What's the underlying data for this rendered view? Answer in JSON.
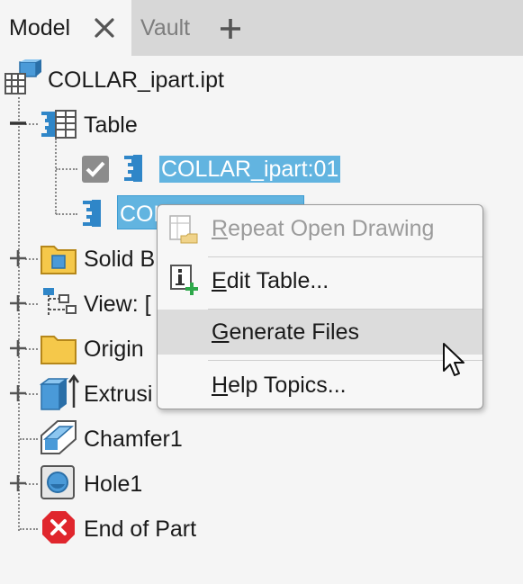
{
  "tabs": {
    "model_label": "Model",
    "vault_label": "Vault"
  },
  "tree": {
    "root_label": "COLLAR_ipart.ipt",
    "table_label": "Table",
    "member1_label": "COLLAR_ipart:01",
    "member2_label_visible": "COL",
    "solid_bodies_label": "Solid B",
    "view_label": "View: [",
    "origin_label": "Origin",
    "extrusion_label": "Extrusi",
    "chamfer_label": "Chamfer1",
    "hole_label": "Hole1",
    "end_label": "End of Part"
  },
  "menu": {
    "items": [
      {
        "mnemonic": "R",
        "rest": "epeat Open Drawing",
        "enabled": false
      },
      {
        "mnemonic": "E",
        "rest": "dit Table...",
        "enabled": true
      },
      {
        "mnemonic": "G",
        "rest": "enerate Files",
        "enabled": true,
        "hovered": true
      },
      {
        "mnemonic": "H",
        "rest": "elp Topics...",
        "enabled": true
      }
    ]
  },
  "colors": {
    "selection": "#62b4e0",
    "tab_bar": "#d7d7d7",
    "panel": "#f5f5f5",
    "menu_hover": "#dcdcdc",
    "end_of_part_red": "#e0262d"
  }
}
